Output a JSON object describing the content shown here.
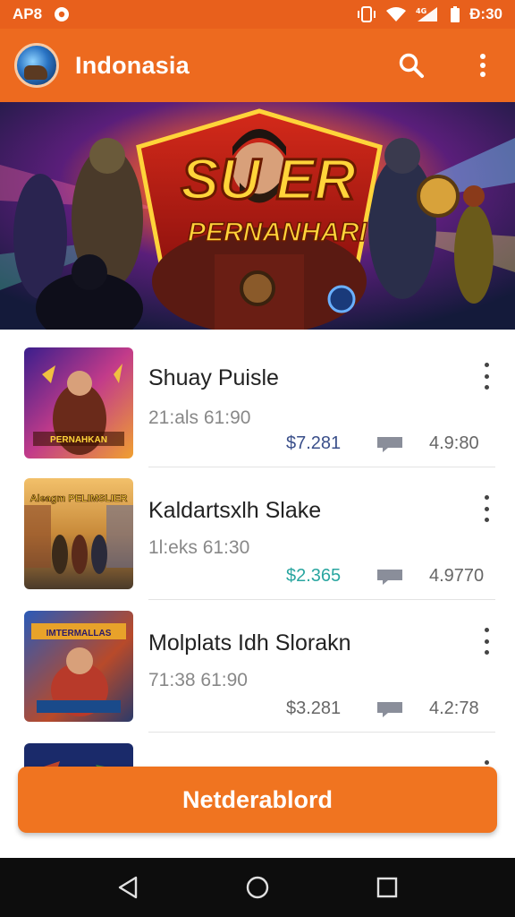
{
  "status_bar": {
    "left_text": "AP8",
    "time": "Ð:30",
    "icons": [
      "notification-icon",
      "vibrate-icon",
      "wifi-icon",
      "signal-icon",
      "battery-icon"
    ]
  },
  "app_bar": {
    "title": "Indonasia",
    "icons": [
      "app-logo",
      "search-icon",
      "more-vert-icon"
    ]
  },
  "banner": {
    "title": "SU ER",
    "subtitle": "PERNANHARI"
  },
  "items": [
    {
      "title": "Shuay Puisle",
      "meta": "21:als  61:90",
      "price": "$7.281",
      "price_color": "#3a4f8a",
      "stat": "4.9:80",
      "thumb_text": "PERNAHKAN",
      "thumb_colors": [
        "#5a1e8c",
        "#c23b8a",
        "#f0a030"
      ]
    },
    {
      "title": "Kaldartsxlh Slake",
      "meta": "1l:eks  61:30",
      "price": "$2.365",
      "price_color": "#2aa6a0",
      "stat": "4.9770",
      "thumb_text": "Aleagm PELIMSLIER",
      "thumb_colors": [
        "#d88a2a",
        "#f2c06a",
        "#5a4a3a"
      ]
    },
    {
      "title": "Molplats Idh Slorakn",
      "meta": "71:38  61:90",
      "price": "$3.281",
      "price_color": "#666666",
      "stat": "4.2:78",
      "thumb_text": "IMTERMALLAS",
      "thumb_colors": [
        "#2a5ab8",
        "#e8a22a",
        "#b83a2a"
      ]
    },
    {
      "title": "",
      "meta": "",
      "price": "",
      "price_color": "#666666",
      "stat": "",
      "thumb_text": "",
      "thumb_colors": [
        "#1a2a6a",
        "#c0452a",
        "#3a8a3a"
      ]
    }
  ],
  "cta": {
    "label": "Netderablord"
  },
  "nav_bar": {
    "icons": [
      "back-icon",
      "home-icon",
      "recents-icon"
    ]
  },
  "colors": {
    "accent": "#ed6a1f",
    "status_bar": "#e8601c",
    "cta": "#f07420",
    "nav_bar": "#0d0d0d"
  }
}
